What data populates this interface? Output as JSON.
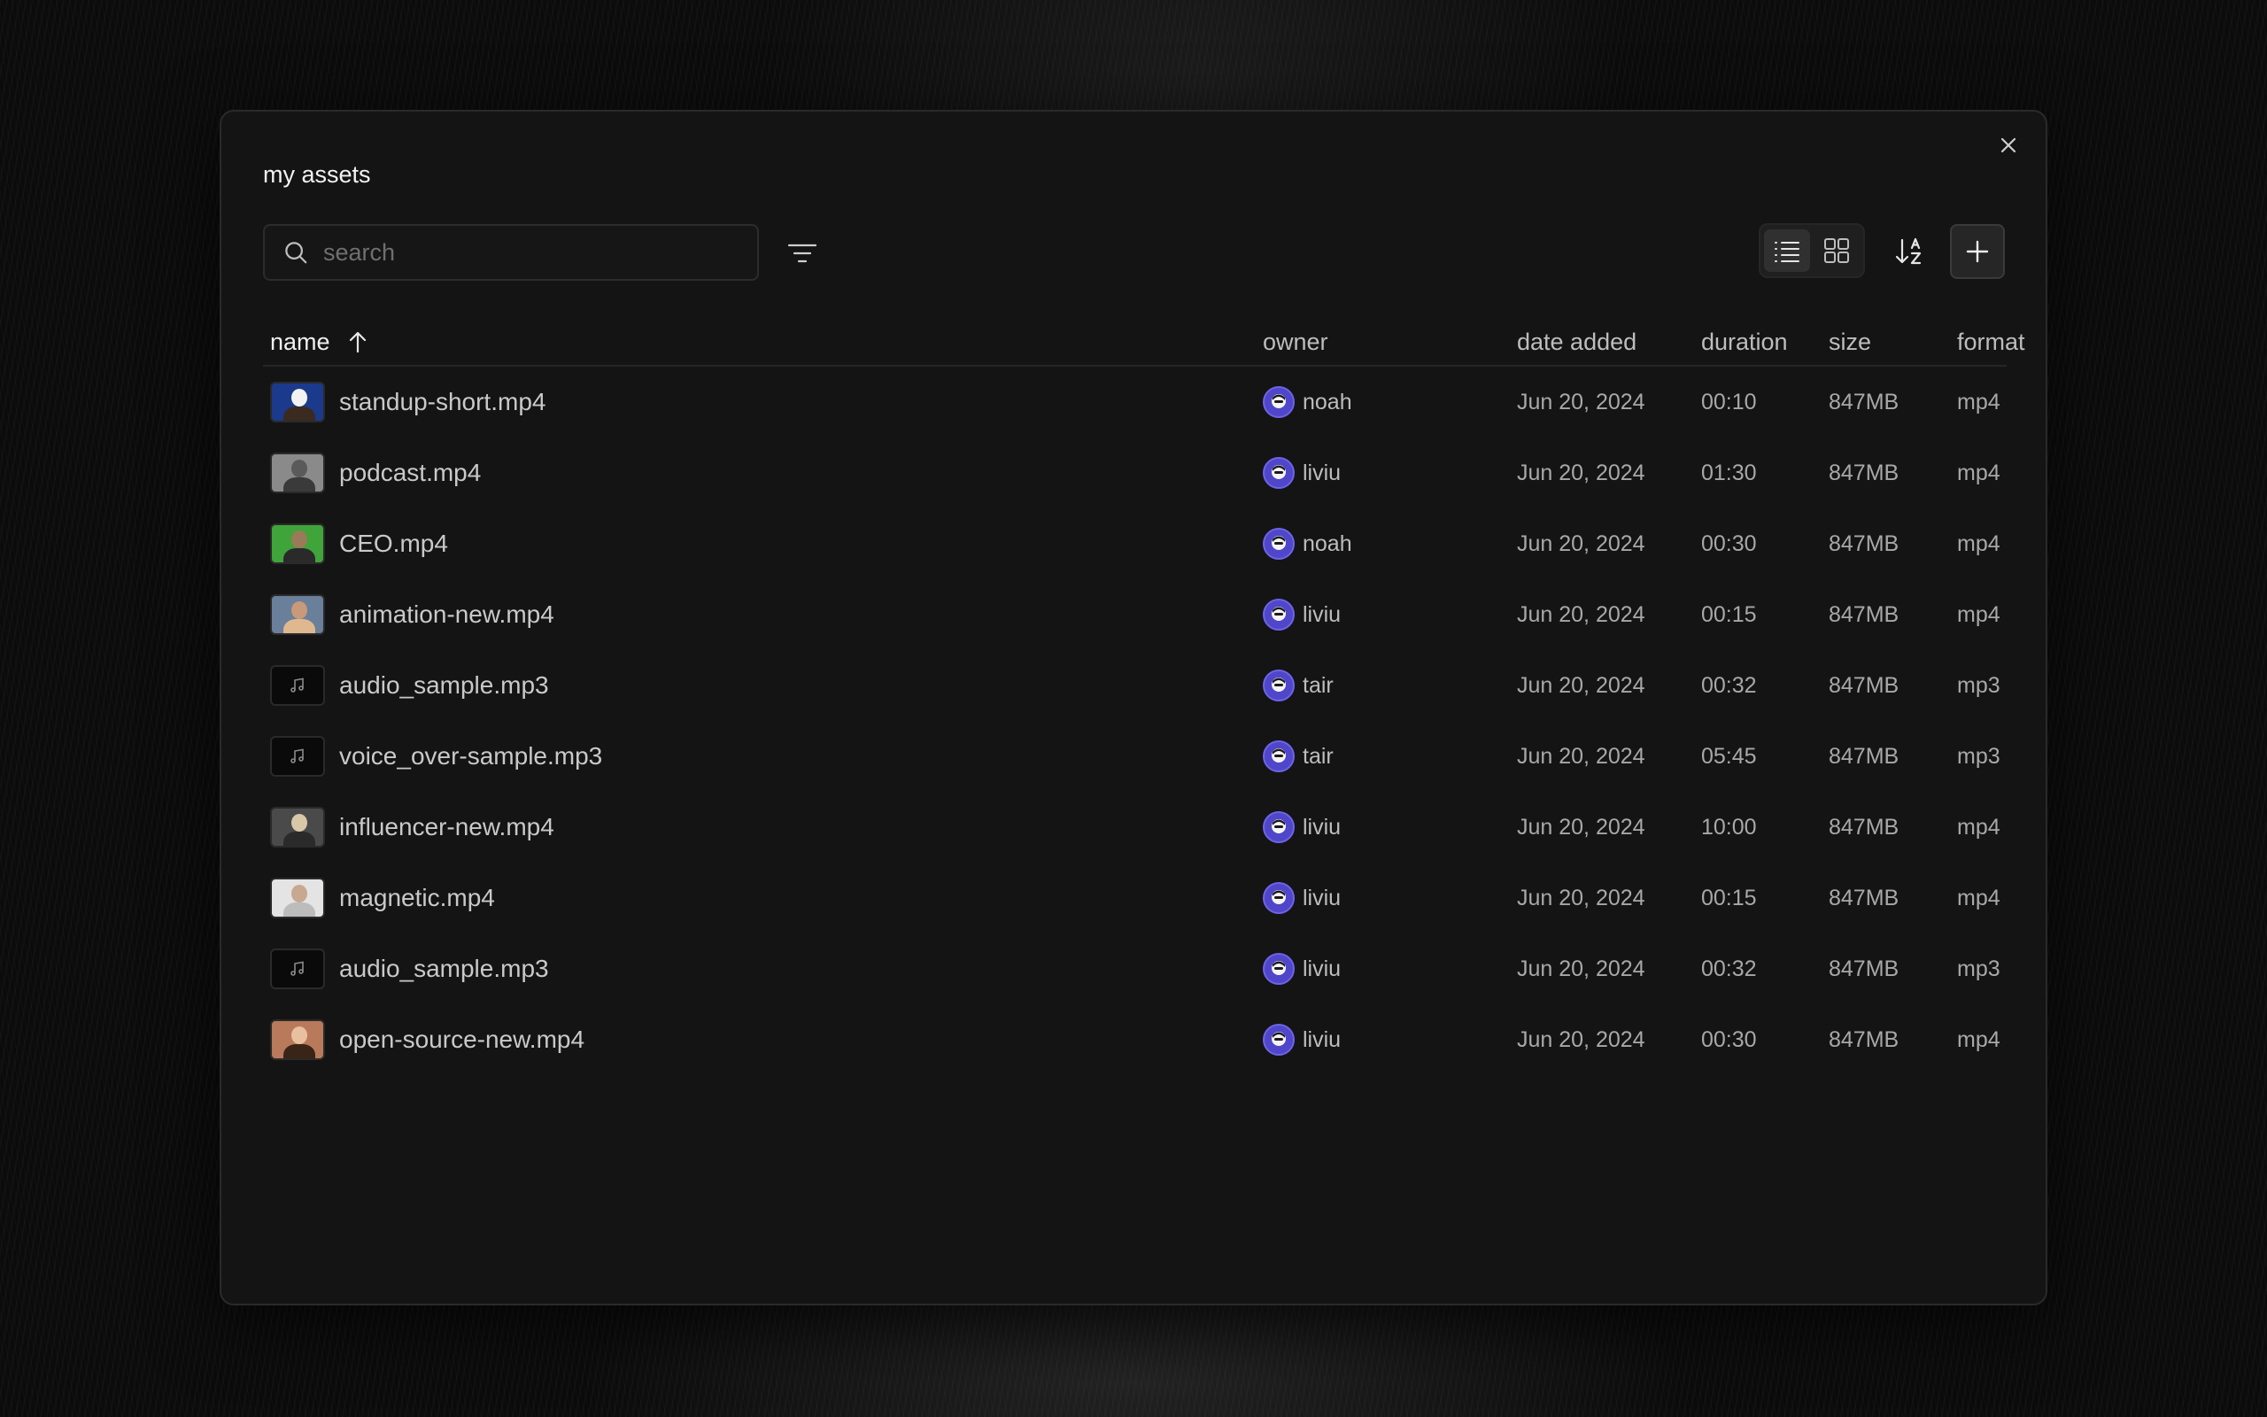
{
  "modal": {
    "title": "my assets",
    "search_placeholder": "search",
    "add_label": "+"
  },
  "columns": {
    "name": "name",
    "owner": "owner",
    "date_added": "date added",
    "duration": "duration",
    "size": "size",
    "format": "format"
  },
  "sort": {
    "column": "name",
    "direction": "ascending"
  },
  "view_mode": "list",
  "rows": [
    {
      "name": "standup-short.mp4",
      "thumb": "video",
      "thumb_colors": [
        "#1b3a8c",
        "#f2f2f2",
        "#3a2a20"
      ],
      "owner": "noah",
      "date": "Jun 20, 2024",
      "duration": "00:10",
      "size": "847MB",
      "format": "mp4"
    },
    {
      "name": "podcast.mp4",
      "thumb": "video",
      "thumb_colors": [
        "#8a8a8a",
        "#5a5a5a",
        "#3a3a3a"
      ],
      "owner": "liviu",
      "date": "Jun 20, 2024",
      "duration": "01:30",
      "size": "847MB",
      "format": "mp4"
    },
    {
      "name": "CEO.mp4",
      "thumb": "video",
      "thumb_colors": [
        "#3fa43a",
        "#9b7a5a",
        "#2a2a2a"
      ],
      "owner": "noah",
      "date": "Jun 20, 2024",
      "duration": "00:30",
      "size": "847MB",
      "format": "mp4"
    },
    {
      "name": "animation-new.mp4",
      "thumb": "video",
      "thumb_colors": [
        "#6a7f9a",
        "#c89a7a",
        "#e0b890"
      ],
      "owner": "liviu",
      "date": "Jun 20, 2024",
      "duration": "00:15",
      "size": "847MB",
      "format": "mp4"
    },
    {
      "name": "audio_sample.mp3",
      "thumb": "audio",
      "owner": "tair",
      "date": "Jun 20, 2024",
      "duration": "00:32",
      "size": "847MB",
      "format": "mp3"
    },
    {
      "name": "voice_over-sample.mp3",
      "thumb": "audio",
      "owner": "tair",
      "date": "Jun 20, 2024",
      "duration": "05:45",
      "size": "847MB",
      "format": "mp3"
    },
    {
      "name": "influencer-new.mp4",
      "thumb": "video",
      "thumb_colors": [
        "#4a4a4a",
        "#d8c8a8",
        "#2a2a2a"
      ],
      "owner": "liviu",
      "date": "Jun 20, 2024",
      "duration": "10:00",
      "size": "847MB",
      "format": "mp4"
    },
    {
      "name": "magnetic.mp4",
      "thumb": "video",
      "thumb_colors": [
        "#e4e4e4",
        "#c8a890",
        "#bcbcbc"
      ],
      "owner": "liviu",
      "date": "Jun 20, 2024",
      "duration": "00:15",
      "size": "847MB",
      "format": "mp4"
    },
    {
      "name": "audio_sample.mp3",
      "thumb": "audio",
      "owner": "liviu",
      "date": "Jun 20, 2024",
      "duration": "00:32",
      "size": "847MB",
      "format": "mp3"
    },
    {
      "name": "open-source-new.mp4",
      "thumb": "video",
      "thumb_colors": [
        "#b87a5a",
        "#e8c0a0",
        "#3a2418"
      ],
      "owner": "liviu",
      "date": "Jun 20, 2024",
      "duration": "00:30",
      "size": "847MB",
      "format": "mp4"
    }
  ],
  "colors": {
    "accent_avatar": "#4f46c9",
    "background": "#0b0b0b",
    "panel": "#141414"
  }
}
